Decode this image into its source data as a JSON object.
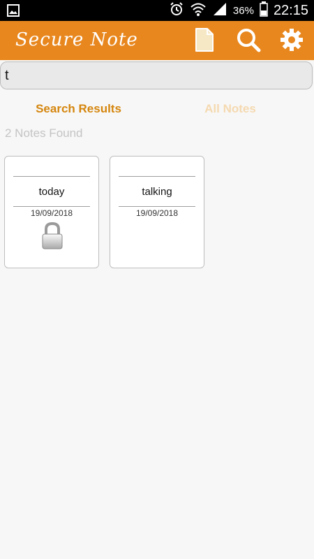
{
  "status_bar": {
    "battery_percent": "36%",
    "time": "22:15",
    "icons": [
      "image-icon",
      "alarm-icon",
      "wifi-icon",
      "signal-icon",
      "battery-icon"
    ]
  },
  "app_bar": {
    "title": "Secure Note",
    "color": "#e8871e",
    "icons": [
      "new-note-icon",
      "search-icon",
      "settings-icon"
    ]
  },
  "search": {
    "value": "t"
  },
  "tabs": [
    {
      "label": "Search Results",
      "active": true
    },
    {
      "label": "All Notes",
      "active": false
    }
  ],
  "results_count": "2 Notes Found",
  "notes": [
    {
      "title": "today",
      "date": "19/09/2018",
      "locked": true
    },
    {
      "title": "talking",
      "date": "19/09/2018",
      "locked": false
    }
  ]
}
